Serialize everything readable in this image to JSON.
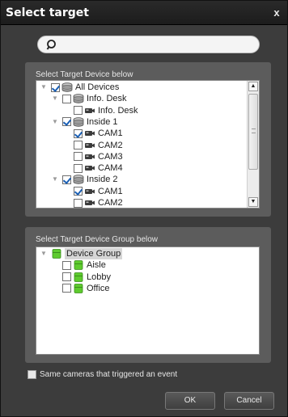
{
  "window": {
    "title": "Select target",
    "close_glyph": "x"
  },
  "search": {
    "value": "",
    "placeholder": ""
  },
  "devices_panel": {
    "label": "Select Target Device below",
    "tree": [
      {
        "label": "All Devices",
        "level": 0,
        "expander": "▼",
        "checked": true,
        "icon": "server-icon"
      },
      {
        "label": "Info. Desk",
        "level": 1,
        "expander": "▼",
        "checked": false,
        "icon": "server-icon"
      },
      {
        "label": "Info. Desk",
        "level": 2,
        "expander": "",
        "checked": false,
        "icon": "camera-icon"
      },
      {
        "label": "Inside 1",
        "level": 1,
        "expander": "▼",
        "checked": true,
        "icon": "server-icon"
      },
      {
        "label": "CAM1",
        "level": 2,
        "expander": "",
        "checked": true,
        "icon": "camera-icon"
      },
      {
        "label": "CAM2",
        "level": 2,
        "expander": "",
        "checked": false,
        "icon": "camera-icon"
      },
      {
        "label": "CAM3",
        "level": 2,
        "expander": "",
        "checked": false,
        "icon": "camera-icon"
      },
      {
        "label": "CAM4",
        "level": 2,
        "expander": "",
        "checked": false,
        "icon": "camera-icon"
      },
      {
        "label": "Inside 2",
        "level": 1,
        "expander": "▼",
        "checked": true,
        "icon": "server-icon"
      },
      {
        "label": "CAM1",
        "level": 2,
        "expander": "",
        "checked": true,
        "icon": "camera-icon"
      },
      {
        "label": "CAM2",
        "level": 2,
        "expander": "",
        "checked": false,
        "icon": "camera-icon"
      }
    ],
    "scrollbar": {
      "up": "▲",
      "down": "▼"
    }
  },
  "groups_panel": {
    "label": "Select Target Device Group below",
    "tree": [
      {
        "label": "Device Group",
        "level": 0,
        "expander": "▼",
        "checkbox": false,
        "checked": false,
        "icon": "group-icon",
        "highlight": true
      },
      {
        "label": "Aisle",
        "level": 1,
        "expander": "",
        "checkbox": true,
        "checked": false,
        "icon": "group-icon",
        "highlight": false
      },
      {
        "label": "Lobby",
        "level": 1,
        "expander": "",
        "checkbox": true,
        "checked": false,
        "icon": "group-icon",
        "highlight": false
      },
      {
        "label": "Office",
        "level": 1,
        "expander": "",
        "checkbox": true,
        "checked": false,
        "icon": "group-icon",
        "highlight": false
      }
    ]
  },
  "same_cameras": {
    "label": "Same cameras that triggered an event",
    "checked": false
  },
  "buttons": {
    "ok": "OK",
    "cancel": "Cancel"
  },
  "colors": {
    "window_bg": "#3c3c3c",
    "panel_bg": "#5c5c5c",
    "titlebar_bg": "#1c1c1c",
    "check_color": "#1a5fb4",
    "group_icon": "#5ecb2e"
  }
}
